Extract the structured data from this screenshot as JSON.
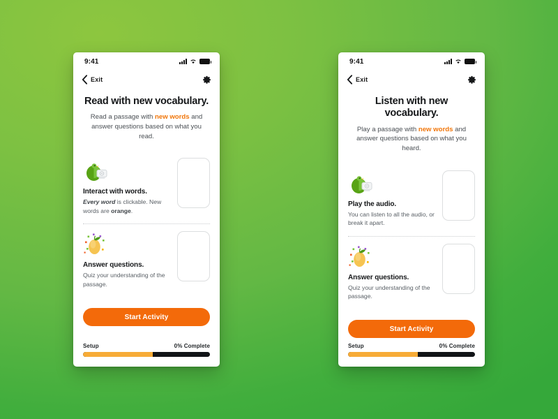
{
  "background": {
    "color_top_left": "#8dc63f",
    "color_bottom_right": "#35a83a"
  },
  "theme": {
    "accent_orange": "#f36a0a",
    "highlight_orange": "#f1760a",
    "progress_fill": "#f7ab37",
    "progress_track": "#111417",
    "character_green": "#58a315"
  },
  "screens": [
    {
      "id": "read-screen",
      "status_bar": {
        "time": "9:41",
        "icons": [
          "signal-icon",
          "wifi-icon",
          "battery-icon"
        ]
      },
      "nav": {
        "back_icon": "chevron-left-icon",
        "back_label": "Exit",
        "settings_icon": "gear-icon"
      },
      "heading": {
        "title": "Read with new vocabulary.",
        "subtitle_pre": "Read a passage with ",
        "subtitle_highlight": "new words",
        "subtitle_post": " and answer questions based on what you read."
      },
      "cards": [
        {
          "art": "green-character-device-icon",
          "title": "Interact with words.",
          "desc_em": "Every word",
          "desc_mid": " is clickable. New words are ",
          "desc_bold": "orange",
          "desc_end": "."
        },
        {
          "art": "mango-confetti-icon",
          "title": "Answer questions.",
          "desc_plain": "Quiz your understanding of the passage."
        }
      ],
      "cta_label": "Start Activity",
      "progress": {
        "stage_label": "Setup",
        "complete_label": "0% Complete",
        "percent": 0,
        "fill_width": "55%"
      }
    },
    {
      "id": "listen-screen",
      "status_bar": {
        "time": "9:41",
        "icons": [
          "signal-icon",
          "wifi-icon",
          "battery-icon"
        ]
      },
      "nav": {
        "back_icon": "chevron-left-icon",
        "back_label": "Exit",
        "settings_icon": "gear-icon"
      },
      "heading": {
        "title": "Listen with new vocabulary.",
        "subtitle_pre": "Play a passage with ",
        "subtitle_highlight": "new words",
        "subtitle_post": " and answer questions based on what you heard."
      },
      "cards": [
        {
          "art": "green-character-device-icon",
          "title": "Play the audio.",
          "desc_plain": "You can listen to all the audio, or break it apart."
        },
        {
          "art": "mango-confetti-icon",
          "title": "Answer questions.",
          "desc_plain": "Quiz your understanding of the passage."
        }
      ],
      "cta_label": "Start Activity",
      "progress": {
        "stage_label": "Setup",
        "complete_label": "0% Complete",
        "percent": 0,
        "fill_width": "55%"
      }
    }
  ]
}
